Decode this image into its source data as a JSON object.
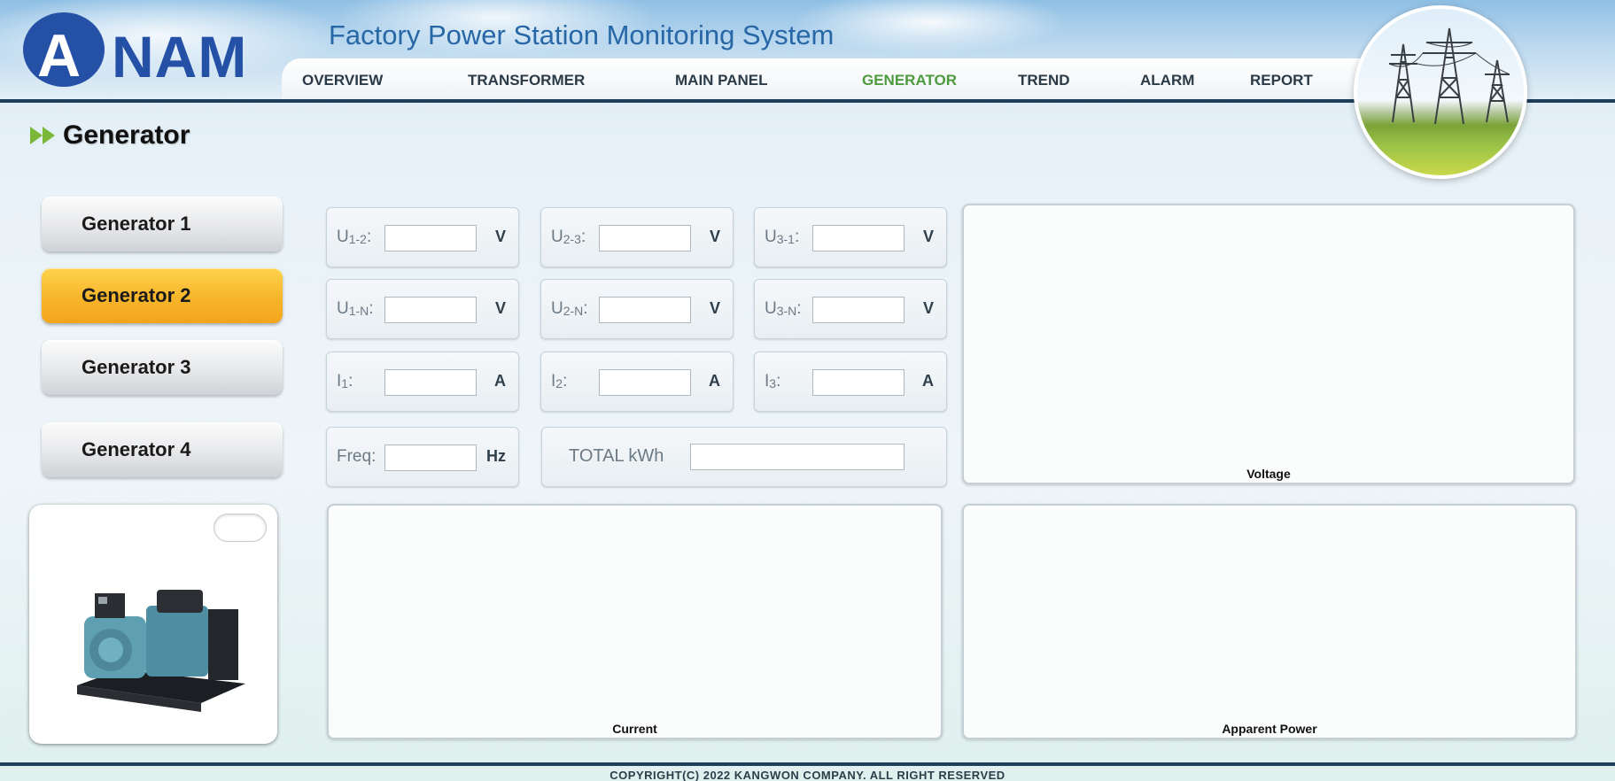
{
  "header": {
    "logo_text_first": "A",
    "logo_text_rest": "NAM",
    "title": "Factory Power Station Monitoring System",
    "nav": [
      {
        "label": "OVERVIEW"
      },
      {
        "label": "TRANSFORMER"
      },
      {
        "label": "MAIN PANEL"
      },
      {
        "label": "GENERATOR",
        "active": true
      },
      {
        "label": "TREND"
      },
      {
        "label": "ALARM"
      },
      {
        "label": "REPORT"
      }
    ],
    "active_color": "#4e9a3f"
  },
  "page": {
    "title": "Generator"
  },
  "generators": [
    {
      "label": "Generator 1",
      "active": false
    },
    {
      "label": "Generator 2",
      "active": true
    },
    {
      "label": "Generator 3",
      "active": false
    },
    {
      "label": "Generator 4",
      "active": false
    }
  ],
  "measurements": {
    "u12": {
      "label_main": "U",
      "label_sub": "1-2",
      "suffix": ":",
      "value": "",
      "unit": "V"
    },
    "u23": {
      "label_main": "U",
      "label_sub": "2-3",
      "suffix": ":",
      "value": "",
      "unit": "V"
    },
    "u31": {
      "label_main": "U",
      "label_sub": "3-1",
      "suffix": ":",
      "value": "",
      "unit": "V"
    },
    "u1n": {
      "label_main": "U",
      "label_sub": "1-N",
      "suffix": ":",
      "value": "",
      "unit": "V"
    },
    "u2n": {
      "label_main": "U",
      "label_sub": "2-N",
      "suffix": ":",
      "value": "",
      "unit": "V"
    },
    "u3n": {
      "label_main": "U",
      "label_sub": "3-N",
      "suffix": ":",
      "value": "",
      "unit": "V"
    },
    "i1": {
      "label_main": "I",
      "label_sub": "1",
      "suffix": ":",
      "value": "",
      "unit": "A"
    },
    "i2": {
      "label_main": "I",
      "label_sub": "2",
      "suffix": ":",
      "value": "",
      "unit": "A"
    },
    "i3": {
      "label_main": "I",
      "label_sub": "3",
      "suffix": ":",
      "value": "",
      "unit": "A"
    },
    "freq": {
      "label_main": "Freq",
      "label_sub": "",
      "suffix": ":",
      "value": "",
      "unit": "Hz"
    },
    "total_kwh": {
      "label": "TOTAL kWh",
      "value": ""
    }
  },
  "panels": {
    "voltage": "Voltage",
    "current": "Current",
    "apparent_power": "Apparent Power"
  },
  "footer": {
    "copyright": "COPYRIGHT(C) 2022 KANGWON COMPANY. ALL RIGHT RESERVED"
  }
}
